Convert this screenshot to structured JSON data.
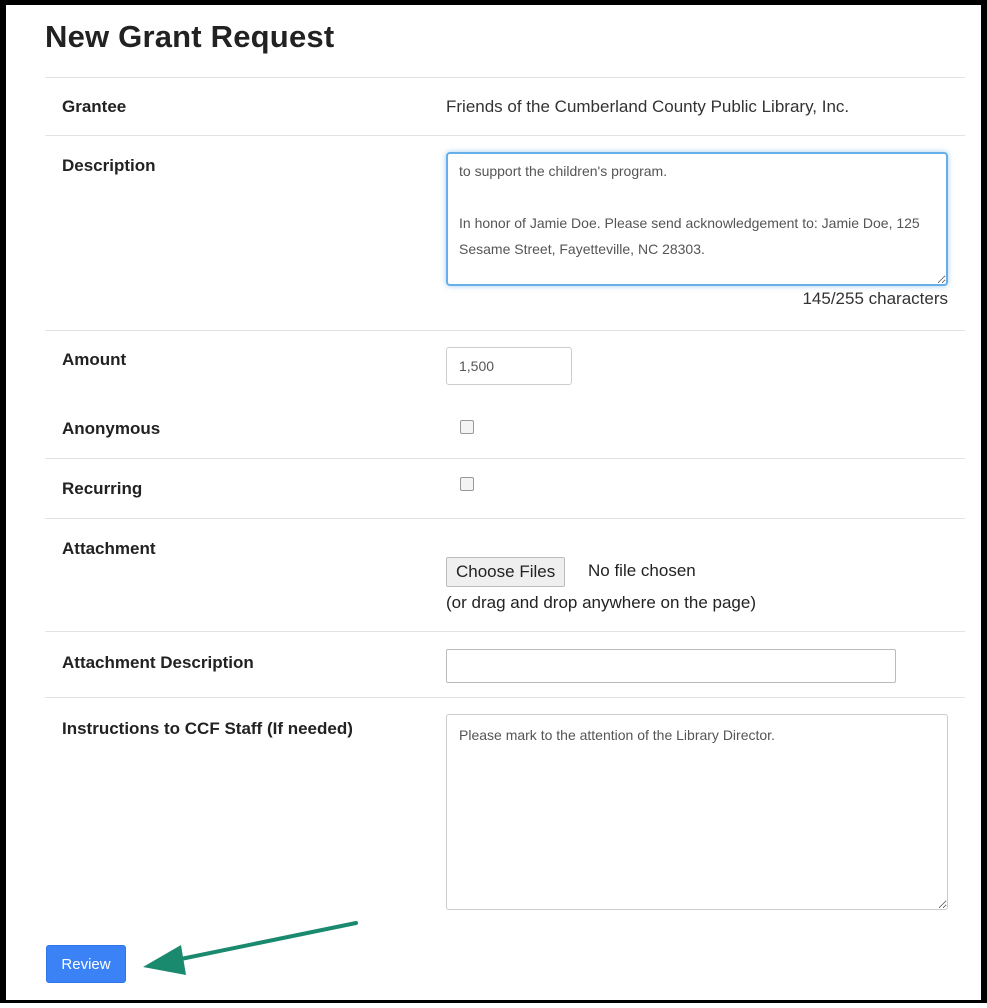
{
  "page": {
    "title": "New Grant Request"
  },
  "form": {
    "grantee": {
      "label": "Grantee",
      "value": "Friends of the Cumberland County Public Library, Inc."
    },
    "description": {
      "label": "Description",
      "value": "to support the children's program.\n\nIn honor of Jamie Doe. Please send acknowledgement to: Jamie Doe, 125 Sesame Street, Fayetteville, NC 28303.",
      "char_count": "145/255 characters"
    },
    "amount": {
      "label": "Amount",
      "value": "1,500"
    },
    "anonymous": {
      "label": "Anonymous",
      "checked": false
    },
    "recurring": {
      "label": "Recurring",
      "checked": false
    },
    "attachment": {
      "label": "Attachment",
      "button_label": "Choose Files",
      "status": "No file chosen",
      "hint": "(or drag and drop anywhere on the page)"
    },
    "attachment_description": {
      "label": "Attachment Description",
      "value": ""
    },
    "instructions": {
      "label": "Instructions to CCF Staff (If needed)",
      "value": "Please mark to the attention of the Library Director."
    }
  },
  "actions": {
    "review_label": "Review"
  },
  "colors": {
    "primary": "#3b82f6",
    "focus_border": "#66afe9",
    "annotation_arrow": "#1a8a6e"
  },
  "icons": {
    "annotation": "arrow-left-icon"
  }
}
